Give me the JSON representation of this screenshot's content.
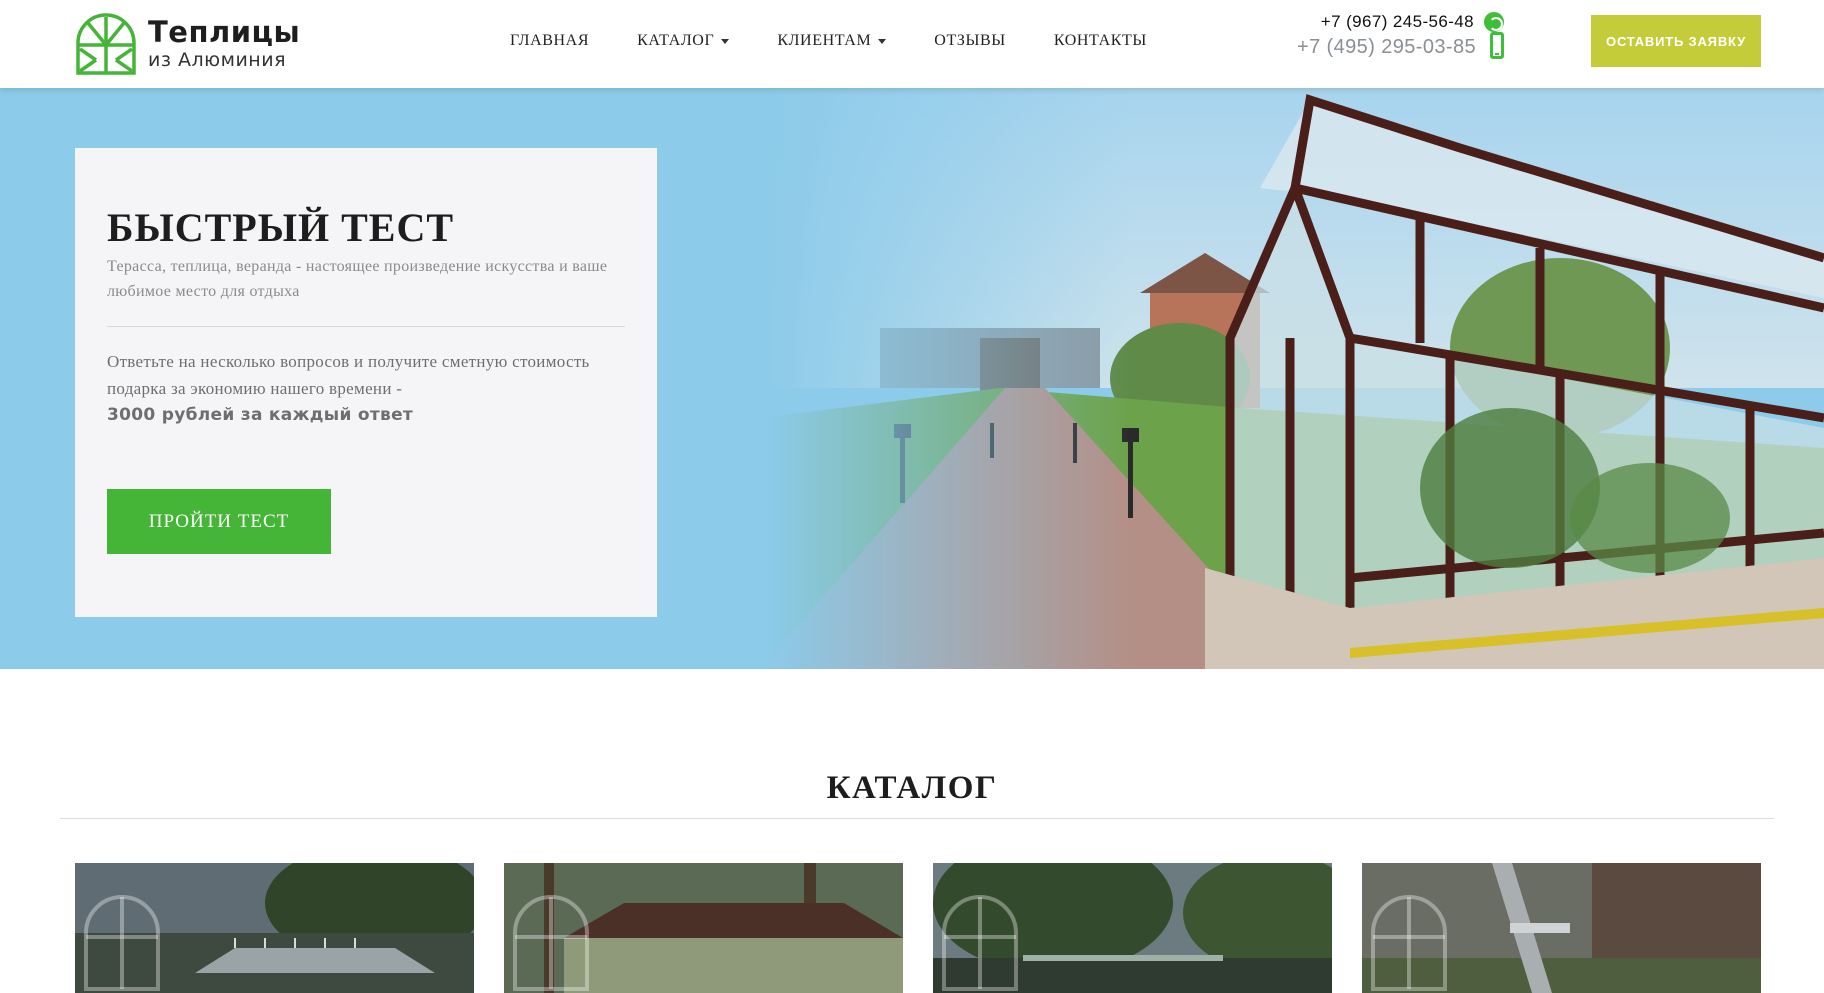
{
  "brand": {
    "title": "Теплицы",
    "subtitle": "из Алюминия",
    "accent": "#44b536"
  },
  "nav": {
    "items": [
      {
        "label": "ГЛАВНАЯ",
        "dropdown": false
      },
      {
        "label": "КАТАЛОГ",
        "dropdown": true
      },
      {
        "label": "КЛИЕНТАМ",
        "dropdown": true
      },
      {
        "label": "ОТЗЫВЫ",
        "dropdown": false
      },
      {
        "label": "КОНТАКТЫ",
        "dropdown": false
      }
    ]
  },
  "contacts": {
    "phone_primary": "+7 (967) 245-56-48",
    "phone_secondary": "+7 (495) 295-03-85",
    "phone_primary_icon": "whatsapp-icon",
    "phone_secondary_icon": "mobile-phone-icon"
  },
  "header": {
    "cta_label": "ОСТАВИТЬ ЗАЯВКУ",
    "cta_color": "#c5cc3a"
  },
  "hero": {
    "title": "БЫСТРЫЙ ТЕСТ",
    "subtitle": "Терасса, теплица, веранда - настоящее произведение искусства и ваше любимое место для отдыха",
    "description": "Ответьте на несколько вопросов и получите сметную стоимость подарка за экономию нашего времени -",
    "highlight": "3000 рублей за каждый ответ",
    "button_label": "ПРОЙТИ ТЕСТ",
    "background_color": "#8ccbea"
  },
  "catalog": {
    "title": "КАТАЛОГ",
    "cards": [
      {
        "name": "catalog-card-1"
      },
      {
        "name": "catalog-card-2"
      },
      {
        "name": "catalog-card-3"
      },
      {
        "name": "catalog-card-4"
      }
    ]
  }
}
